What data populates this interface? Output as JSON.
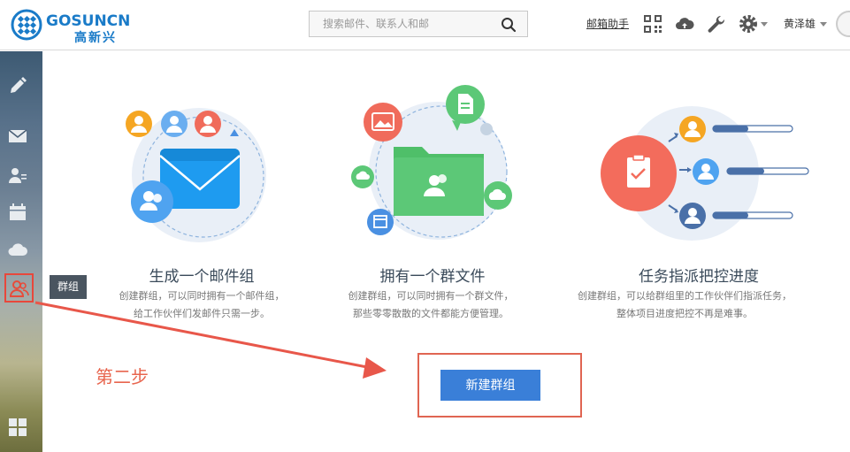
{
  "header": {
    "logo_text": "GOSUNCN",
    "logo_sub": "高新兴",
    "search_placeholder": "搜索邮件、联系人和邮",
    "helper_link": "邮箱助手",
    "user_name": "黄泽雄"
  },
  "sidebar": {
    "tooltip": "群组"
  },
  "features": [
    {
      "title": "生成一个邮件组",
      "desc_line1": "创建群组，可以同时拥有一个邮件组，",
      "desc_line2": "给工作伙伴们发邮件只需一步。"
    },
    {
      "title": "拥有一个群文件",
      "desc_line1": "创建群组，可以同时拥有一个群文件，",
      "desc_line2": "那些零零散散的文件都能方便管理。"
    },
    {
      "title": "任务指派把控进度",
      "desc_line1": "创建群组，可以给群组里的工作伙伴们指派任务，",
      "desc_line2": "整体项目进度把控不再是难事。"
    }
  ],
  "actions": {
    "new_group_label": "新建群组"
  },
  "annotation": {
    "step_label": "第二步"
  },
  "colors": {
    "accent_blue": "#3a7fd8",
    "annotation_red": "#e06552",
    "envelope_blue": "#1e9bf0",
    "folder_green": "#5cc877",
    "task_red": "#f36c5c"
  }
}
